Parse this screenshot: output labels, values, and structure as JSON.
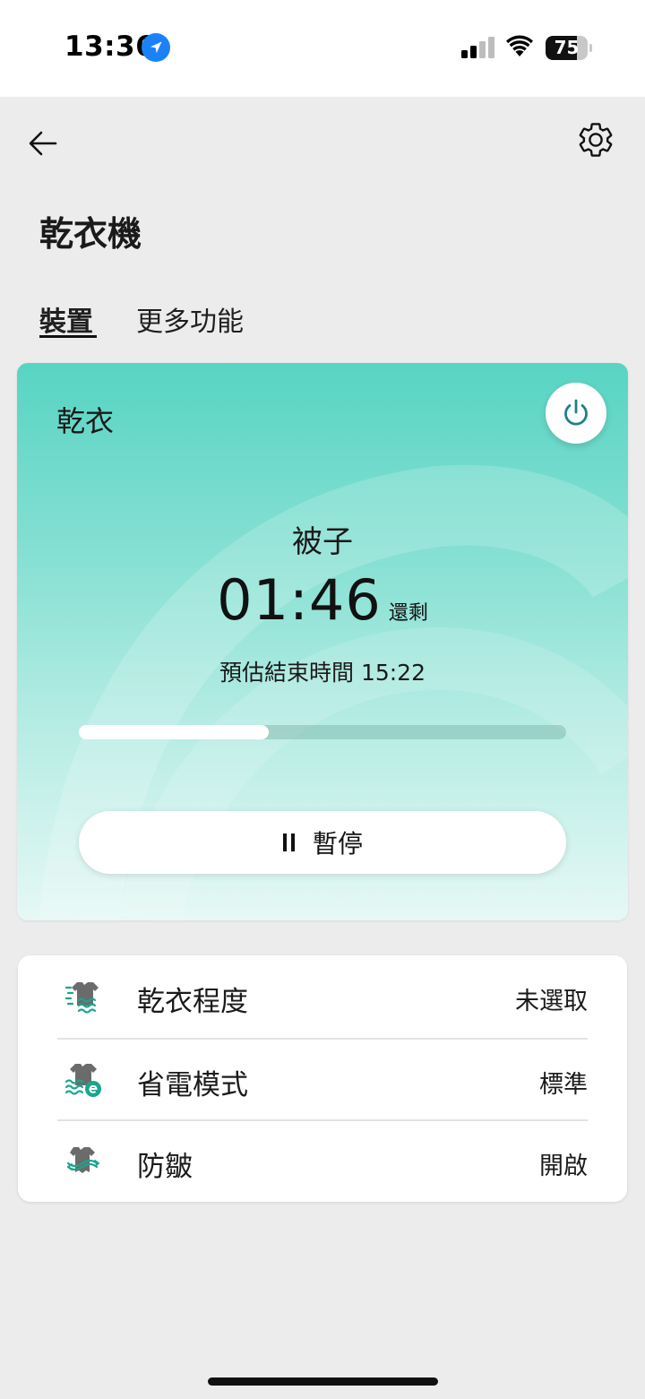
{
  "status_bar": {
    "time": "13:36",
    "battery": "75",
    "battery_level": 0.75
  },
  "header": {
    "title": "乾衣機"
  },
  "tabs": [
    {
      "label": "裝置",
      "active": true
    },
    {
      "label": "更多功能",
      "active": false
    }
  ],
  "card": {
    "mode_label": "乾衣",
    "program": "被子",
    "remaining_time": "01:46",
    "remaining_suffix": "還剩",
    "end_time": "預估結束時間 15:22",
    "progress": 0.39,
    "pause_label": "暫停",
    "gradient_top": "#58d4c3",
    "gradient_bottom": "#e6f8f5",
    "power_color": "#1f7f88"
  },
  "settings": [
    {
      "icon": "dry-level-icon",
      "label": "乾衣程度",
      "value": "未選取"
    },
    {
      "icon": "eco-mode-icon",
      "label": "省電模式",
      "value": "標準"
    },
    {
      "icon": "anti-wrinkle-icon",
      "label": "防皺",
      "value": "開啟"
    }
  ]
}
